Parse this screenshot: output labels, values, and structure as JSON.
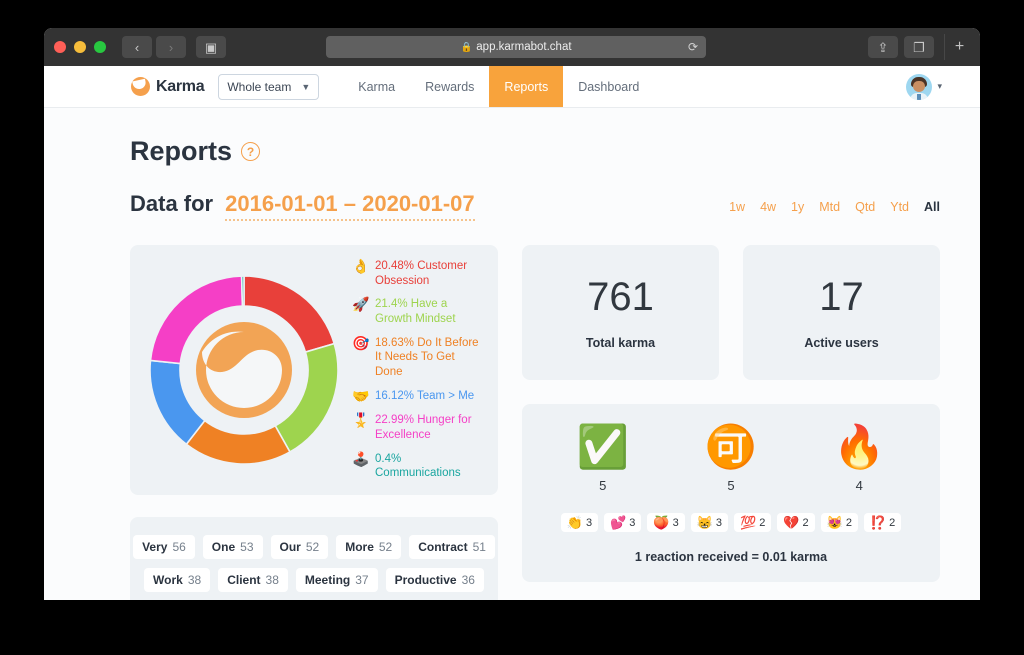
{
  "browser": {
    "url": "app.karmabot.chat",
    "lock_icon": "lock-icon",
    "back_icon": "‹",
    "forward_icon": "›",
    "sidebar_icon": "▣",
    "reload_icon": "⟳",
    "share_icon": "⇪",
    "tabs_icon": "❐",
    "newtab_icon": "+"
  },
  "appbar": {
    "brand": "Karma",
    "team_selector": {
      "value": "Whole team",
      "caret": "▼"
    },
    "nav": [
      {
        "label": "Karma",
        "active": false
      },
      {
        "label": "Rewards",
        "active": false
      },
      {
        "label": "Reports",
        "active": true
      },
      {
        "label": "Dashboard",
        "active": false
      }
    ],
    "user_caret": "▾"
  },
  "page": {
    "title": "Reports",
    "help_glyph": "?",
    "data_for_label": "Data for",
    "date_range": "2016-01-01 – 2020-01-07",
    "ranges": [
      {
        "label": "1w",
        "active": false
      },
      {
        "label": "4w",
        "active": false
      },
      {
        "label": "1y",
        "active": false
      },
      {
        "label": "Mtd",
        "active": false
      },
      {
        "label": "Qtd",
        "active": false
      },
      {
        "label": "Ytd",
        "active": false
      },
      {
        "label": "All",
        "active": true
      }
    ]
  },
  "chart_data": {
    "type": "pie",
    "title": "Karma values distribution",
    "legend_position": "right",
    "categories": [
      "Customer Obsession",
      "Have a Growth Mindset",
      "Do It Before It Needs To Get Done",
      "Team > Me",
      "Hunger for Excellence",
      "Communications"
    ],
    "values": [
      20.48,
      21.4,
      18.63,
      16.12,
      22.99,
      0.4
    ],
    "unit": "%",
    "labels": [
      "20.48% Customer Obsession",
      "21.4% Have a Growth Mindset",
      "18.63% Do It Before It Needs To Get Done",
      "16.12% Team > Me",
      "22.99% Hunger for Excellence",
      "0.4% Communications"
    ],
    "emojis": [
      "👌",
      "🚀",
      "🎯",
      "🤝",
      "🎖️",
      "🕹️"
    ],
    "colors": [
      "#e8403a",
      "#9ed44e",
      "#ef8124",
      "#4a97ef",
      "#f53fc6",
      "#1aa6a0"
    ]
  },
  "stats": [
    {
      "value": "761",
      "label": "Total karma"
    },
    {
      "value": "17",
      "label": "Active users"
    }
  ],
  "reactions": {
    "top": [
      {
        "emoji": "✅",
        "name": "check-mark-button-emoji",
        "count": "5"
      },
      {
        "emoji": "🉑",
        "name": "japanese-acceptable-button-emoji",
        "count": "5"
      },
      {
        "emoji": "🔥",
        "name": "fire-emoji",
        "count": "4"
      }
    ],
    "chips": [
      {
        "emoji": "👏",
        "name": "clapping-hands-emoji",
        "count": "3"
      },
      {
        "emoji": "💕",
        "name": "two-hearts-emoji",
        "count": "3"
      },
      {
        "emoji": "🍑",
        "name": "peach-emoji",
        "count": "3"
      },
      {
        "emoji": "😸",
        "name": "grinning-cat-emoji",
        "count": "3"
      },
      {
        "emoji": "💯",
        "name": "hundred-points-emoji",
        "count": "2"
      },
      {
        "emoji": "💔",
        "name": "broken-heart-emoji",
        "count": "2"
      },
      {
        "emoji": "😻",
        "name": "heart-eyes-cat-emoji",
        "count": "2"
      },
      {
        "emoji": "⁉️",
        "name": "exclamation-question-mark-emoji",
        "count": "2"
      }
    ],
    "note": "1 reaction received = 0.01 karma"
  },
  "tags": [
    [
      {
        "word": "Very",
        "count": "56"
      },
      {
        "word": "One",
        "count": "53"
      },
      {
        "word": "Our",
        "count": "52"
      },
      {
        "word": "More",
        "count": "52"
      },
      {
        "word": "Contract",
        "count": "51"
      }
    ],
    [
      {
        "word": "Work",
        "count": "38"
      },
      {
        "word": "Client",
        "count": "38"
      },
      {
        "word": "Meeting",
        "count": "37"
      },
      {
        "word": "Productive",
        "count": "36"
      }
    ]
  ]
}
